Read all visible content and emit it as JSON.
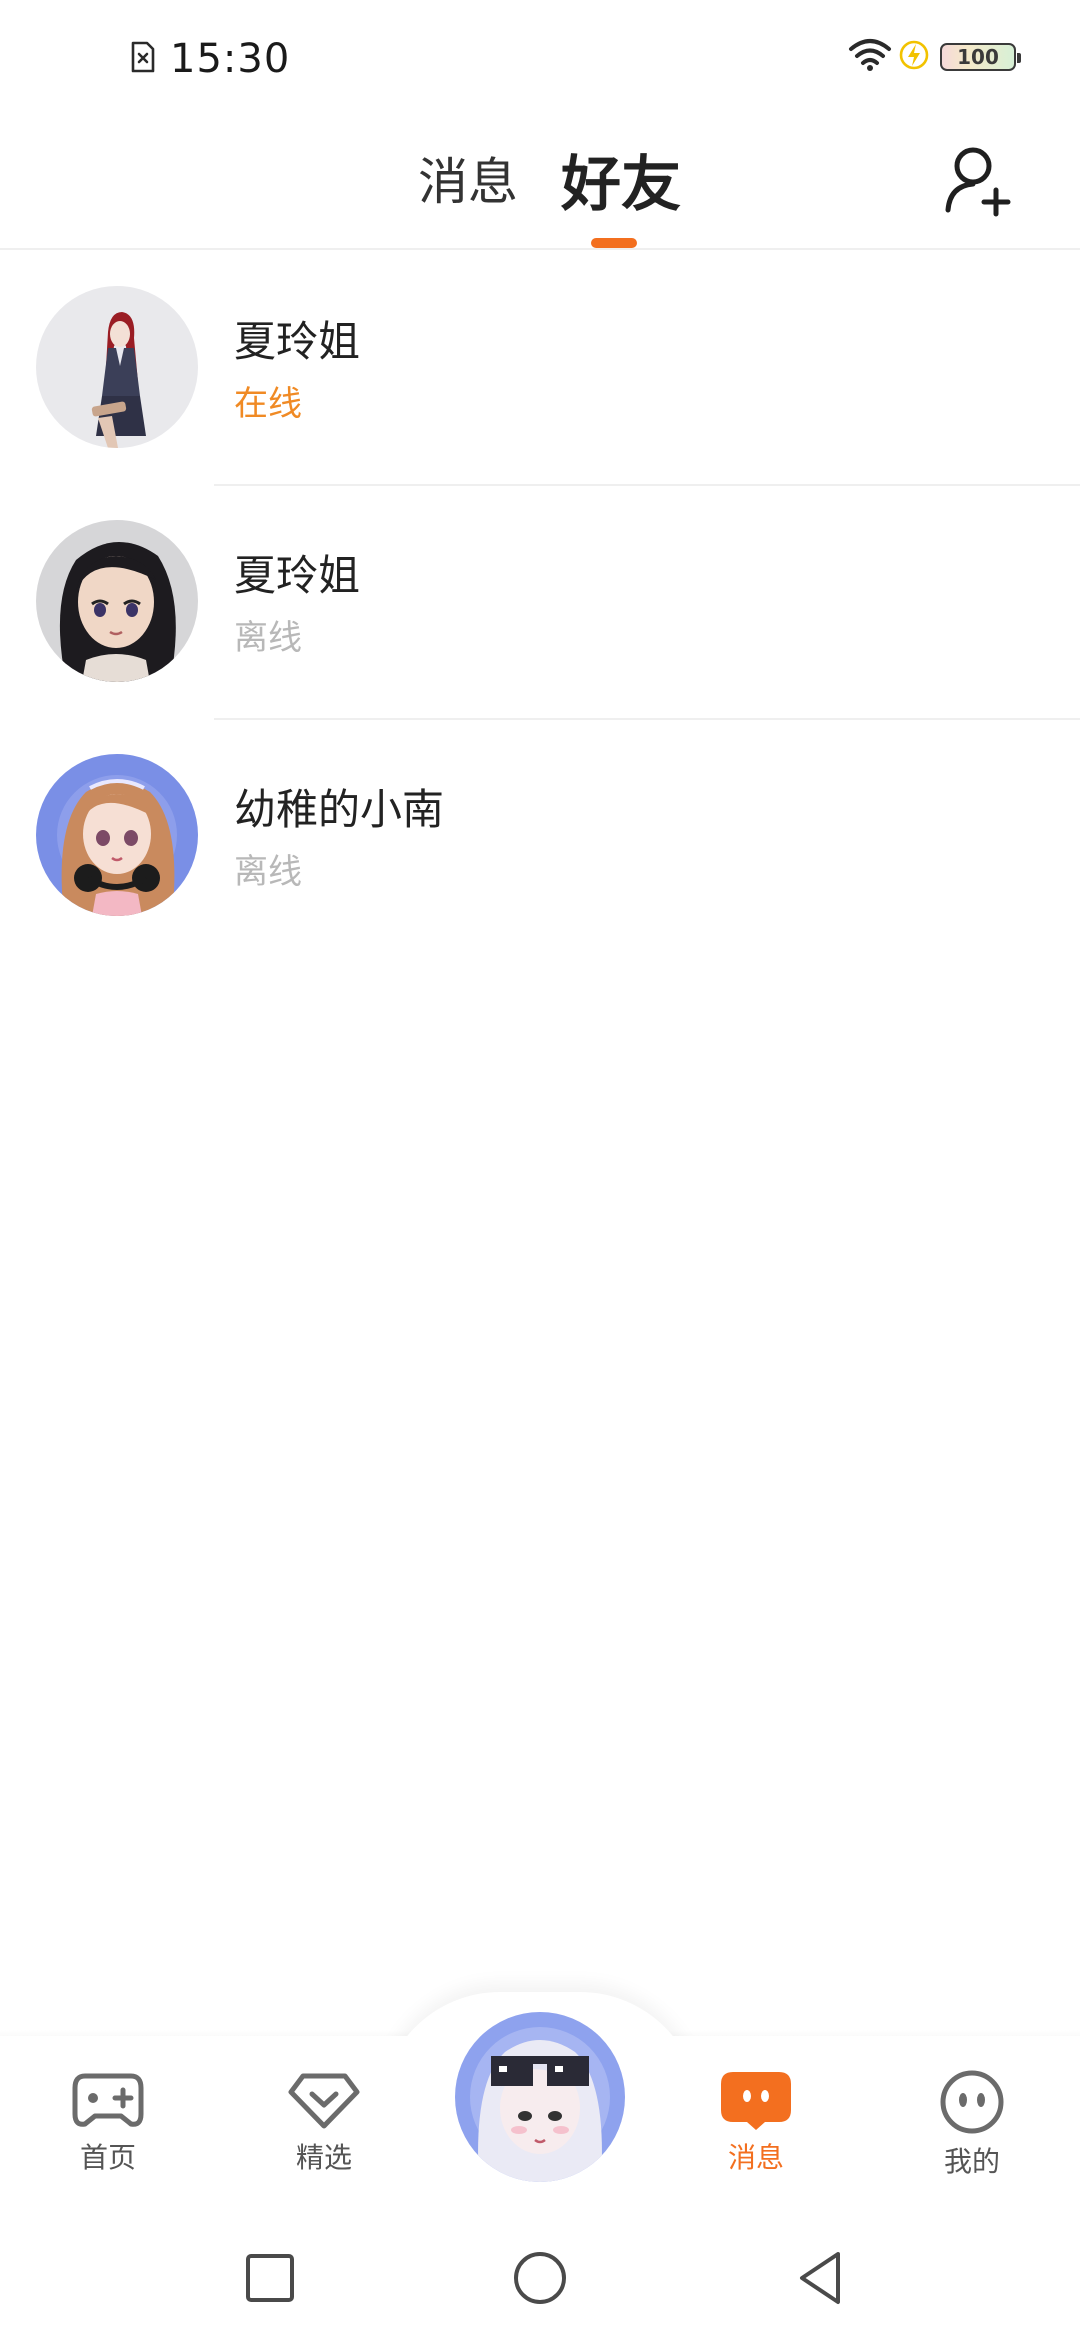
{
  "status_bar": {
    "time": "15:30",
    "battery": "100",
    "icons": [
      "sim-off-icon",
      "wifi-icon",
      "charging-icon",
      "battery-icon"
    ]
  },
  "header": {
    "tabs": [
      {
        "label": "消息",
        "active": false
      },
      {
        "label": "好友",
        "active": true
      }
    ],
    "accent_color": "#f36f1f",
    "right_icon": "add-friend-icon"
  },
  "friends": [
    {
      "name": "夏玲姐",
      "status": "在线",
      "online": true
    },
    {
      "name": "夏玲姐",
      "status": "离线",
      "online": false
    },
    {
      "name": "幼稚的小南",
      "status": "离线",
      "online": false
    }
  ],
  "bottom_nav": {
    "items": [
      {
        "label": "首页",
        "icon": "gamepad-icon",
        "active": false
      },
      {
        "label": "精选",
        "icon": "diamond-heart-icon",
        "active": false
      },
      {
        "label": "消息",
        "icon": "message-bubble-icon",
        "active": true
      },
      {
        "label": "我的",
        "icon": "face-icon",
        "active": false
      }
    ],
    "center_icon": "avatar-center-icon"
  },
  "system_nav": {
    "icons": [
      "recent-apps-icon",
      "home-icon",
      "back-icon"
    ]
  }
}
